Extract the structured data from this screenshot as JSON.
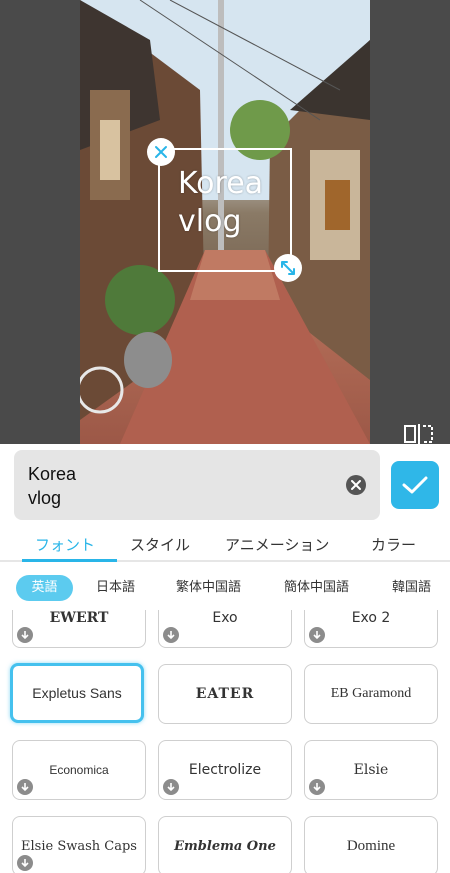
{
  "overlay_text": "Korea\nvlog",
  "input": {
    "value": "Korea\nvlog"
  },
  "tabs": [
    {
      "label": "フォント",
      "active": true
    },
    {
      "label": "スタイル",
      "active": false
    },
    {
      "label": "アニメーション",
      "active": false
    },
    {
      "label": "カラー",
      "active": false
    }
  ],
  "languages": [
    {
      "label": "英語",
      "active": true
    },
    {
      "label": "日本語",
      "active": false
    },
    {
      "label": "繁体中国語",
      "active": false
    },
    {
      "label": "簡体中国語",
      "active": false
    },
    {
      "label": "韓国語",
      "active": false
    }
  ],
  "fonts": [
    {
      "name": "EWERT",
      "download": true
    },
    {
      "name": "Exo",
      "download": true
    },
    {
      "name": "Exo 2",
      "download": true
    },
    {
      "name": "Expletus Sans",
      "download": false,
      "selected": true
    },
    {
      "name": "EATER",
      "download": false
    },
    {
      "name": "EB Garamond",
      "download": false
    },
    {
      "name": "Economica",
      "download": true
    },
    {
      "name": "Electrolize",
      "download": true
    },
    {
      "name": "Elsie",
      "download": true
    },
    {
      "name": "Elsie Swash Caps",
      "download": true
    },
    {
      "name": "Emblema One",
      "download": false
    },
    {
      "name": "Domine",
      "download": false
    }
  ],
  "colors": {
    "accent": "#29b5e8",
    "chip_active": "#5ccbef"
  }
}
